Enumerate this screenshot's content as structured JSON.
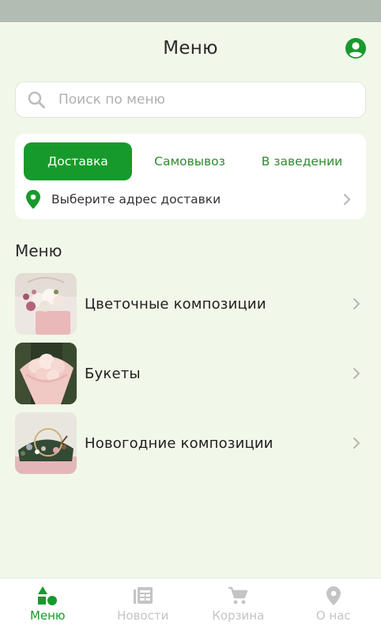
{
  "header": {
    "title": "Меню"
  },
  "search": {
    "placeholder": "Поиск по меню",
    "value": ""
  },
  "delivery": {
    "tabs": [
      {
        "label": "Доставка",
        "active": true
      },
      {
        "label": "Самовывоз",
        "active": false
      },
      {
        "label": "В заведении",
        "active": false
      }
    ],
    "address_prompt": "Выберите адрес доставки"
  },
  "menu": {
    "section_title": "Меню",
    "categories": [
      {
        "label": "Цветочные композиции",
        "image": "flower-arrangement-photo"
      },
      {
        "label": "Букеты",
        "image": "bouquet-photo"
      },
      {
        "label": "Новогодние композиции",
        "image": "new-year-arrangement-photo"
      }
    ]
  },
  "bottom_nav": [
    {
      "label": "Меню",
      "icon": "shapes-icon",
      "active": true
    },
    {
      "label": "Новости",
      "icon": "news-icon",
      "active": false
    },
    {
      "label": "Корзина",
      "icon": "cart-icon",
      "active": false
    },
    {
      "label": "О нас",
      "icon": "location-pin-icon",
      "active": false
    }
  ],
  "colors": {
    "accent": "#179a2c",
    "accent_text": "#2e8b2e",
    "background": "#f1f8e9",
    "inactive_nav": "#c4c4c4"
  }
}
